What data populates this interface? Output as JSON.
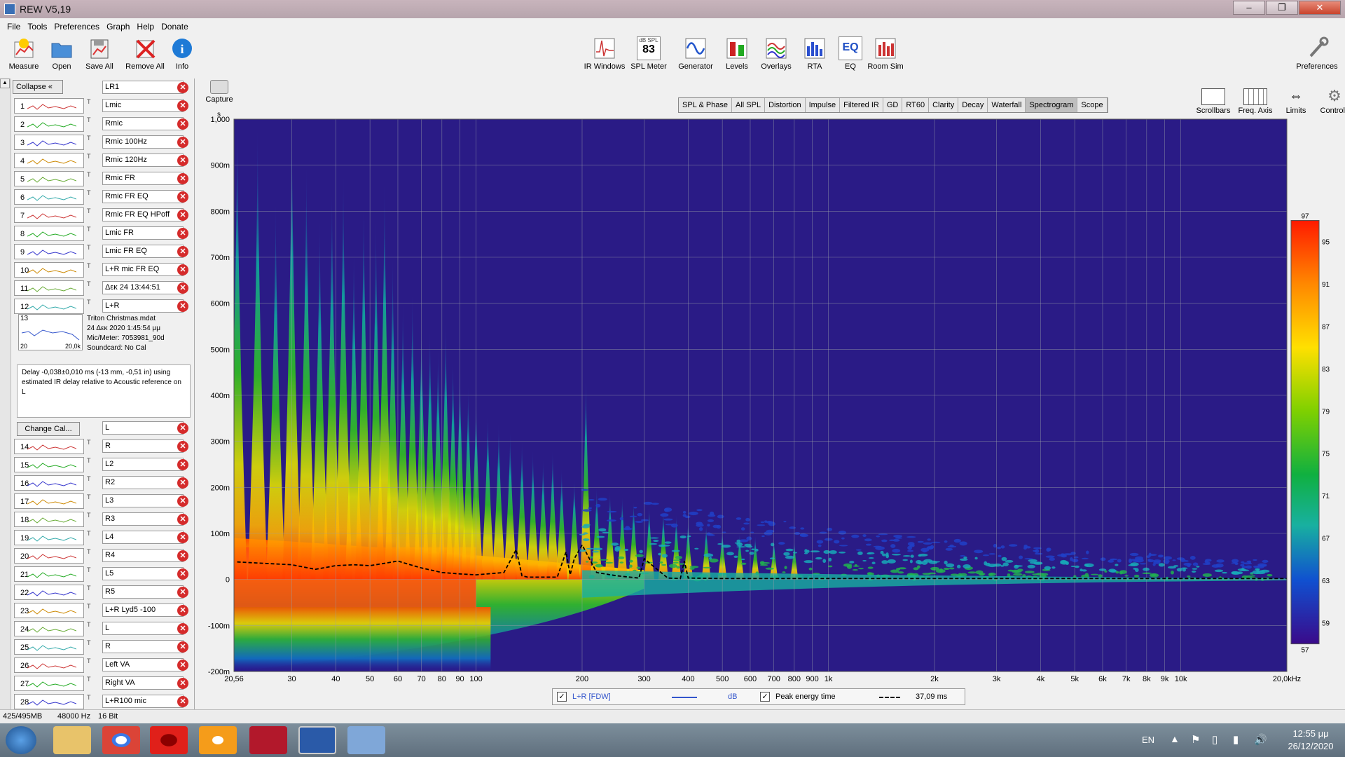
{
  "window": {
    "title": "REW V5,19",
    "min": "–",
    "max": "❐",
    "close": "✕"
  },
  "menu": [
    "File",
    "Tools",
    "Preferences",
    "Graph",
    "Help",
    "Donate"
  ],
  "toolbar": {
    "left": [
      {
        "label": "Measure",
        "icon": "measure-icon"
      },
      {
        "label": "Open",
        "icon": "folder-open-icon"
      },
      {
        "label": "Save All",
        "icon": "save-all-icon"
      },
      {
        "label": "Remove All",
        "icon": "remove-all-icon"
      },
      {
        "label": "Info",
        "icon": "info-icon"
      }
    ],
    "center": [
      {
        "label": "IR Windows",
        "icon": "ir-windows-icon"
      },
      {
        "label": "SPL Meter",
        "icon": "spl-meter-icon",
        "top_text": "dB SPL",
        "value": "83"
      },
      {
        "label": "Generator",
        "icon": "generator-icon"
      },
      {
        "label": "Levels",
        "icon": "levels-icon"
      },
      {
        "label": "Overlays",
        "icon": "overlays-icon"
      },
      {
        "label": "RTA",
        "icon": "rta-icon"
      },
      {
        "label": "EQ",
        "icon": "eq-icon",
        "top_text": "EQ"
      },
      {
        "label": "Room Sim",
        "icon": "room-sim-icon"
      }
    ],
    "preferences": {
      "label": "Preferences",
      "icon": "wrench-icon"
    }
  },
  "panel": {
    "collapse_label": "Collapse",
    "top_name": "LR1",
    "measurements_a": [
      {
        "num": "1",
        "name": "Lmic"
      },
      {
        "num": "2",
        "name": "Rmic"
      },
      {
        "num": "3",
        "name": "Rmic 100Hz"
      },
      {
        "num": "4",
        "name": "Rmic 120Hz"
      },
      {
        "num": "5",
        "name": "Rmic FR"
      },
      {
        "num": "6",
        "name": "Rmic FR EQ"
      },
      {
        "num": "7",
        "name": "Rmic FR EQ HPoff"
      },
      {
        "num": "8",
        "name": "Lmic FR"
      },
      {
        "num": "9",
        "name": "Lmic FR EQ"
      },
      {
        "num": "10",
        "name": "L+R mic FR EQ"
      },
      {
        "num": "11",
        "name": "Δεκ 24 13:44:51"
      },
      {
        "num": "12",
        "name": "L+R"
      }
    ],
    "selected": {
      "num": "13",
      "xmin": "20",
      "xmax": "20,0k",
      "name": "L",
      "file": "Triton Christmas.mdat",
      "date": "24 Δεκ 2020 1:45:54 μμ",
      "mic": "Mic/Meter: 7053981_90d",
      "soundcard": "Soundcard: No Cal",
      "delay_note": "Delay -0,038±0,010 ms (-13 mm, -0,51 in) using estimated IR delay relative to Acoustic reference on  L",
      "change_cal": "Change Cal..."
    },
    "measurements_b": [
      {
        "num": "14",
        "name": "R"
      },
      {
        "num": "15",
        "name": "L2"
      },
      {
        "num": "16",
        "name": "R2"
      },
      {
        "num": "17",
        "name": "L3"
      },
      {
        "num": "18",
        "name": "R3"
      },
      {
        "num": "19",
        "name": "L4"
      },
      {
        "num": "20",
        "name": "R4"
      },
      {
        "num": "21",
        "name": "L5"
      },
      {
        "num": "22",
        "name": "R5"
      },
      {
        "num": "23",
        "name": "L+R Lyd5 -100"
      },
      {
        "num": "24",
        "name": "L"
      },
      {
        "num": "25",
        "name": "R"
      },
      {
        "num": "26",
        "name": "Left VA"
      },
      {
        "num": "27",
        "name": "Right VA"
      },
      {
        "num": "28",
        "name": "L+R100  mic"
      }
    ]
  },
  "graph": {
    "capture_label": "Capture",
    "tabs": [
      "SPL & Phase",
      "All SPL",
      "Distortion",
      "Impulse",
      "Filtered IR",
      "GD",
      "RT60",
      "Clarity",
      "Decay",
      "Waterfall",
      "Spectrogram",
      "Scope"
    ],
    "active_tab": "Spectrogram",
    "right_buttons": [
      {
        "label": "Scrollbars",
        "icon": "scrollbars-icon"
      },
      {
        "label": "Freq. Axis",
        "icon": "freq-axis-icon"
      },
      {
        "label": "Limits",
        "icon": "limits-icon"
      },
      {
        "label": "Controls",
        "icon": "gear-icon"
      }
    ],
    "y_unit": "s",
    "legend": {
      "series1": "L+R [FDW]",
      "unit1": "dB",
      "series2": "Peak energy time",
      "value2": "37,09 ms"
    }
  },
  "chart_data": {
    "type": "heatmap",
    "xscale": "log",
    "xlim": [
      20.56,
      20000
    ],
    "ylim": [
      -200,
      1000
    ],
    "x_ticks": [
      {
        "v": 20.56,
        "label": "20,56"
      },
      {
        "v": 30,
        "label": "30"
      },
      {
        "v": 40,
        "label": "40"
      },
      {
        "v": 50,
        "label": "50"
      },
      {
        "v": 60,
        "label": "60"
      },
      {
        "v": 70,
        "label": "70"
      },
      {
        "v": 80,
        "label": "80"
      },
      {
        "v": 90,
        "label": "90"
      },
      {
        "v": 100,
        "label": "100"
      },
      {
        "v": 200,
        "label": "200"
      },
      {
        "v": 300,
        "label": "300"
      },
      {
        "v": 400,
        "label": "400"
      },
      {
        "v": 500,
        "label": "500"
      },
      {
        "v": 600,
        "label": "600"
      },
      {
        "v": 700,
        "label": "700"
      },
      {
        "v": 800,
        "label": "800"
      },
      {
        "v": 900,
        "label": "900"
      },
      {
        "v": 1000,
        "label": "1k"
      },
      {
        "v": 2000,
        "label": "2k"
      },
      {
        "v": 3000,
        "label": "3k"
      },
      {
        "v": 4000,
        "label": "4k"
      },
      {
        "v": 5000,
        "label": "5k"
      },
      {
        "v": 6000,
        "label": "6k"
      },
      {
        "v": 7000,
        "label": "7k"
      },
      {
        "v": 8000,
        "label": "8k"
      },
      {
        "v": 9000,
        "label": "9k"
      },
      {
        "v": 10000,
        "label": "10k"
      },
      {
        "v": 20000,
        "label": "20,0kHz"
      }
    ],
    "y_ticks": [
      {
        "v": 1000,
        "label": "1,000"
      },
      {
        "v": 900,
        "label": "900m"
      },
      {
        "v": 800,
        "label": "800m"
      },
      {
        "v": 700,
        "label": "700m"
      },
      {
        "v": 600,
        "label": "600m"
      },
      {
        "v": 500,
        "label": "500m"
      },
      {
        "v": 400,
        "label": "400m"
      },
      {
        "v": 300,
        "label": "300m"
      },
      {
        "v": 200,
        "label": "200m"
      },
      {
        "v": 100,
        "label": "100m"
      },
      {
        "v": 0,
        "label": "0"
      },
      {
        "v": -100,
        "label": "-100m"
      },
      {
        "v": -200,
        "label": "-200m"
      }
    ],
    "colorbar": {
      "min": 57,
      "max": 97,
      "ticks": [
        "97",
        "95",
        "91",
        "87",
        "83",
        "79",
        "75",
        "71",
        "67",
        "63",
        "59",
        "57"
      ]
    },
    "peak_energy_line": {
      "x": [
        21,
        25,
        30,
        35,
        40,
        45,
        50,
        55,
        60,
        65,
        70,
        80,
        90,
        100,
        120,
        130,
        135,
        140,
        150,
        170,
        180,
        185,
        190,
        200,
        220,
        250,
        290,
        300,
        350,
        380,
        390,
        400,
        500,
        1000,
        2000,
        5000,
        10000,
        20000
      ],
      "y": [
        38,
        35,
        32,
        22,
        30,
        32,
        30,
        35,
        40,
        32,
        25,
        15,
        12,
        10,
        15,
        65,
        8,
        5,
        5,
        5,
        60,
        10,
        45,
        75,
        15,
        8,
        3,
        45,
        3,
        2,
        40,
        3,
        2,
        2,
        2,
        2,
        2,
        2
      ]
    },
    "legend_colors": {
      "series1": "#3355cc",
      "series2": "#000000"
    }
  },
  "status": {
    "memory": "425/495MB",
    "rate": "48000 Hz",
    "bits": "16 Bit"
  },
  "taskbar": {
    "lang": "EN",
    "time": "12:55 μμ",
    "date": "26/12/2020"
  }
}
